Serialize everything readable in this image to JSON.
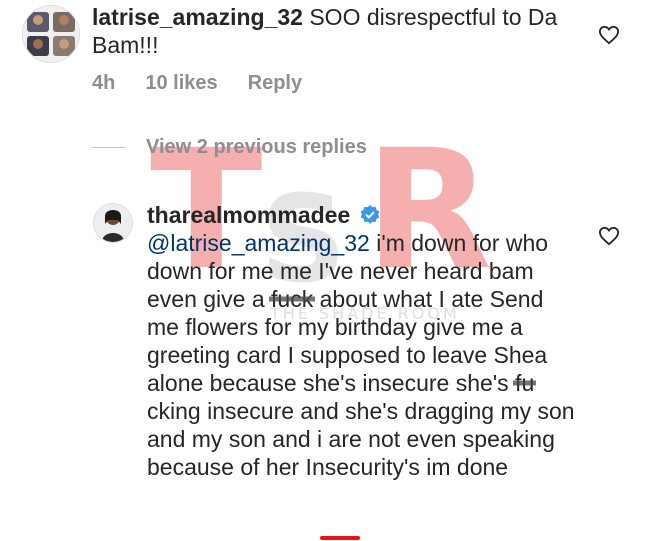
{
  "comment1": {
    "username": "latrise_amazing_32",
    "text": " SOO disrespectful to Da Bam!!!",
    "time": "4h",
    "likes": "10 likes",
    "reply": "Reply"
  },
  "replies": {
    "view_label": "View 2 previous replies"
  },
  "comment2": {
    "username": "tharealmommadee",
    "mention": "@latrise_amazing_32",
    "text_a": " i'm down for who down for me me I've never heard bam even give a ",
    "censored_1": "fuck",
    "text_b": " about what I ate Send me flowers for my birthday give me a greeting card I supposed to leave Shea alone because she's insecure she's ",
    "censored_2": "fu",
    "text_c": "cking insecure and she's dragging my son and my son and i are not even speaking because of her Insecurity's im done"
  },
  "watermark": {
    "letters": [
      "T",
      "S",
      "R"
    ],
    "sub": "THE SHADE ROOM"
  },
  "colors": {
    "verified": "#3897f0",
    "mention": "#003569",
    "muted": "#8e8e8e",
    "watermark": "#ed6e6e"
  },
  "icons": [
    "heart-icon",
    "verified-badge-icon"
  ]
}
